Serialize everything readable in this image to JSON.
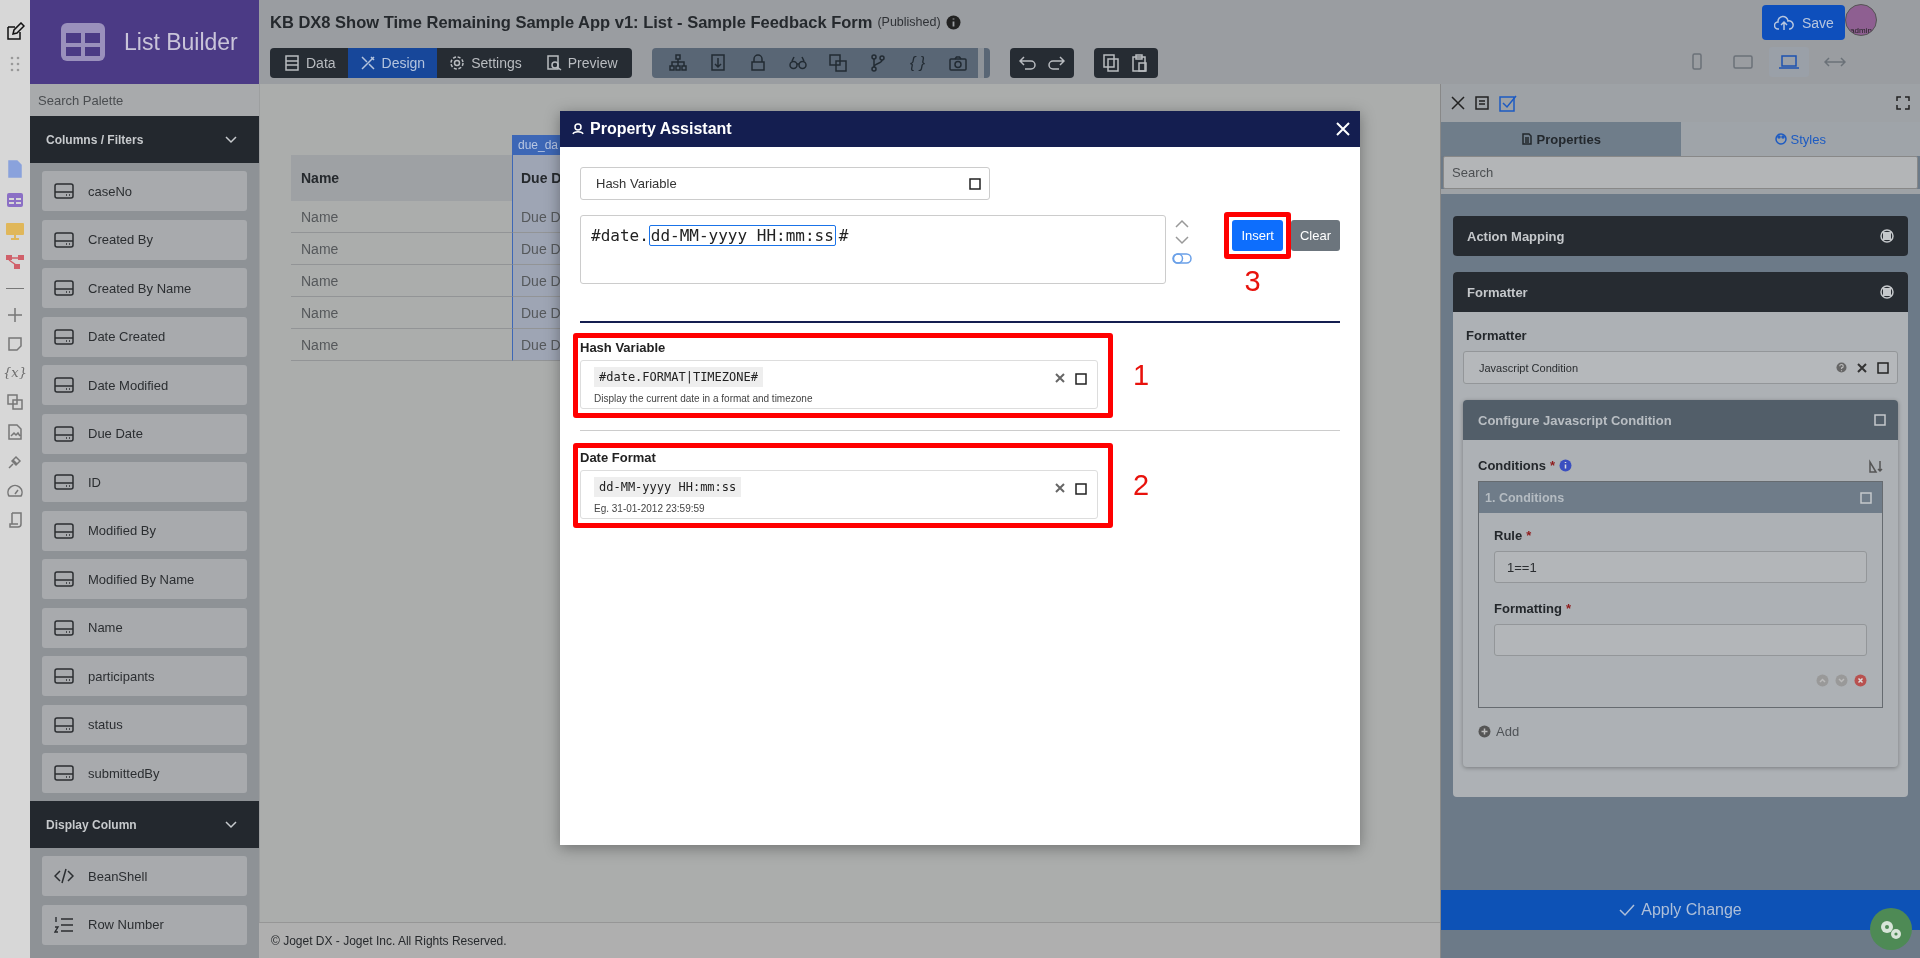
{
  "rail": {
    "variables_label": "{x}"
  },
  "palette": {
    "title": "List Builder",
    "search_placeholder": "Search Palette",
    "sections": [
      {
        "title": "Columns / Filters",
        "items": [
          {
            "label": "caseNo",
            "kind": "column"
          },
          {
            "label": "Created By",
            "kind": "column"
          },
          {
            "label": "Created By Name",
            "kind": "column"
          },
          {
            "label": "Date Created",
            "kind": "column"
          },
          {
            "label": "Date Modified",
            "kind": "column"
          },
          {
            "label": "Due Date",
            "kind": "column"
          },
          {
            "label": "ID",
            "kind": "column"
          },
          {
            "label": "Modified By",
            "kind": "column"
          },
          {
            "label": "Modified By Name",
            "kind": "column"
          },
          {
            "label": "Name",
            "kind": "column"
          },
          {
            "label": "participants",
            "kind": "column"
          },
          {
            "label": "status",
            "kind": "column"
          },
          {
            "label": "submittedBy",
            "kind": "column"
          }
        ]
      },
      {
        "title": "Display Column",
        "items": [
          {
            "label": "BeanShell",
            "kind": "code"
          },
          {
            "label": "Row Number",
            "kind": "row-number"
          }
        ]
      }
    ]
  },
  "header": {
    "title": "KB DX8 Show Time Remaining Sample App v1: List - Sample Feedback Form",
    "status": "(Published)",
    "tool_glyph": "{ }",
    "tabs": [
      {
        "label": "Data",
        "selected": false
      },
      {
        "label": "Design",
        "selected": true
      },
      {
        "label": "Settings",
        "selected": false
      },
      {
        "label": "Preview",
        "selected": false
      }
    ],
    "save": "Save",
    "user": "admin",
    "devices": [
      {
        "kind": "phone",
        "selected": false
      },
      {
        "kind": "tablet",
        "selected": false
      },
      {
        "kind": "laptop",
        "selected": true
      },
      {
        "kind": "full-width",
        "selected": false
      }
    ]
  },
  "canvas": {
    "columns": [
      {
        "label": "Name",
        "selected": false
      },
      {
        "label": "Due D",
        "selected": true,
        "tag": "due_da"
      }
    ],
    "rows": [
      [
        "Name",
        "Due D"
      ],
      [
        "Name",
        "Due D"
      ],
      [
        "Name",
        "Due D"
      ],
      [
        "Name",
        "Due D"
      ],
      [
        "Name",
        "Due D"
      ]
    ]
  },
  "footer": "© Joget DX - Joget Inc. All Rights Reserved.",
  "modal": {
    "title": "Property Assistant",
    "selector": "Hash Variable",
    "expression": {
      "before": "#date.",
      "selected": "dd-MM-yyyy HH:mm:ss",
      "after": "#"
    },
    "buttons": [
      {
        "label": "Insert",
        "kind": "primary",
        "marker": "3"
      },
      {
        "label": "Clear",
        "kind": "secondary"
      }
    ],
    "sections": [
      {
        "label": "Hash Variable",
        "code": "#date.FORMAT|TIMEZONE#",
        "hint": "Display the current date in a format and timezone",
        "marker": "1"
      },
      {
        "label": "Date Format",
        "code": "dd-MM-yyyy HH:mm:ss",
        "hint": "Eg. 31-01-2012 23:59:59",
        "marker": "2"
      }
    ]
  },
  "properties": {
    "tabs": [
      {
        "label": "Properties",
        "selected": true
      },
      {
        "label": "Styles",
        "selected": false
      }
    ],
    "search_placeholder": "Search",
    "panels": [
      {
        "title": "Action Mapping",
        "expanded": false
      },
      {
        "title": "Formatter",
        "expanded": true,
        "field_label": "Formatter",
        "field_value": "Javascript Condition",
        "config": {
          "title": "Configure Javascript Condition",
          "list_label": "Conditions",
          "mark": "*",
          "items": [
            {
              "title": "1. Conditions",
              "fields": [
                {
                  "label": "Rule",
                  "mark": "*",
                  "value": "1==1"
                },
                {
                  "label": "Formatting",
                  "mark": "*"
                }
              ]
            }
          ],
          "add": "Add"
        }
      }
    ],
    "apply": "Apply Change"
  }
}
